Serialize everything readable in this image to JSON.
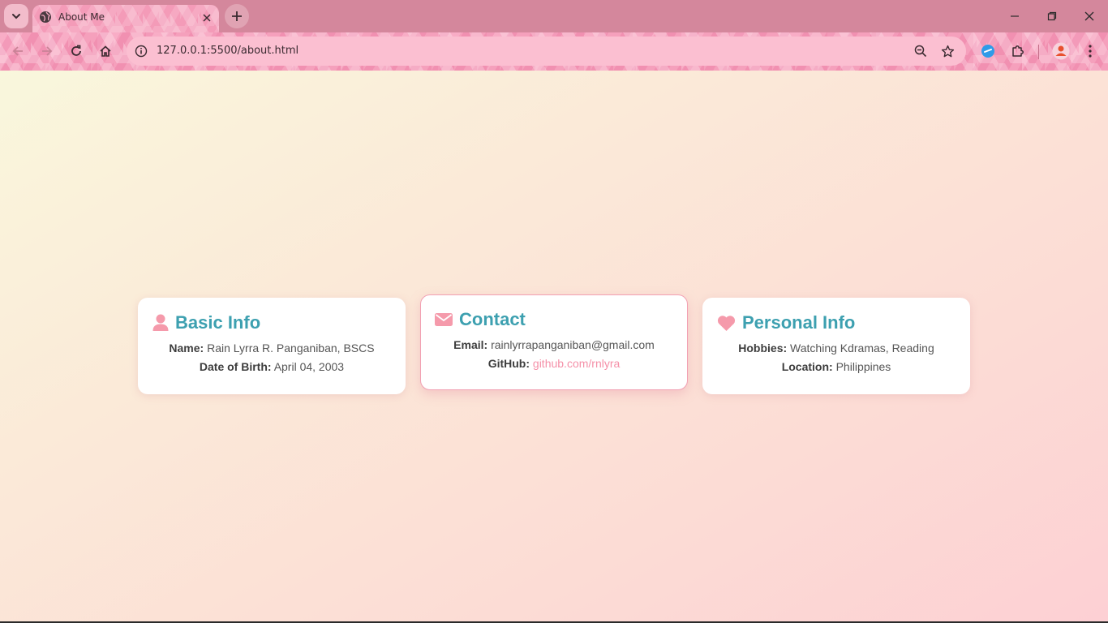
{
  "browser": {
    "tab": {
      "title": "About Me"
    },
    "address_bar": {
      "url": "127.0.0.1:5500/about.html"
    },
    "icons": {
      "tab_search": "chevron-down-icon",
      "favicon": "globe-icon",
      "close_tab": "close-icon",
      "new_tab": "plus-icon",
      "back": "arrow-left-icon",
      "forward": "arrow-right-icon",
      "reload": "reload-icon",
      "home": "home-icon",
      "site_info": "info-icon",
      "zoom": "zoom-out-icon",
      "bookmark": "star-icon",
      "extension_1": "blue-circle-extension-icon",
      "extensions": "puzzle-icon",
      "profile": "avatar-icon",
      "menu": "kebab-menu-icon",
      "minimize": "minimize-icon",
      "restore": "restore-icon",
      "close_window": "close-icon"
    }
  },
  "cards": [
    {
      "title": "Basic Info",
      "icon": "user-icon",
      "rows": [
        {
          "label": "Name:",
          "value": "Rain Lyrra R. Panganiban, BSCS"
        },
        {
          "label": "Date of Birth:",
          "value": "April 04, 2003"
        }
      ]
    },
    {
      "title": "Contact",
      "icon": "envelope-icon",
      "rows": [
        {
          "label": "Email:",
          "value": "rainlyrrapanganiban@gmail.com"
        },
        {
          "label": "GitHub:",
          "value": "github.com/rnlyra"
        }
      ]
    },
    {
      "title": "Personal Info",
      "icon": "heart-icon",
      "rows": [
        {
          "label": "Hobbies:",
          "value": "Watching Kdramas, Reading"
        },
        {
          "label": "Location:",
          "value": "Philippines"
        }
      ]
    }
  ],
  "colors": {
    "heading": "#3da0b0",
    "accent_pink": "#f590a8",
    "tabstrip": "#d4879c"
  }
}
